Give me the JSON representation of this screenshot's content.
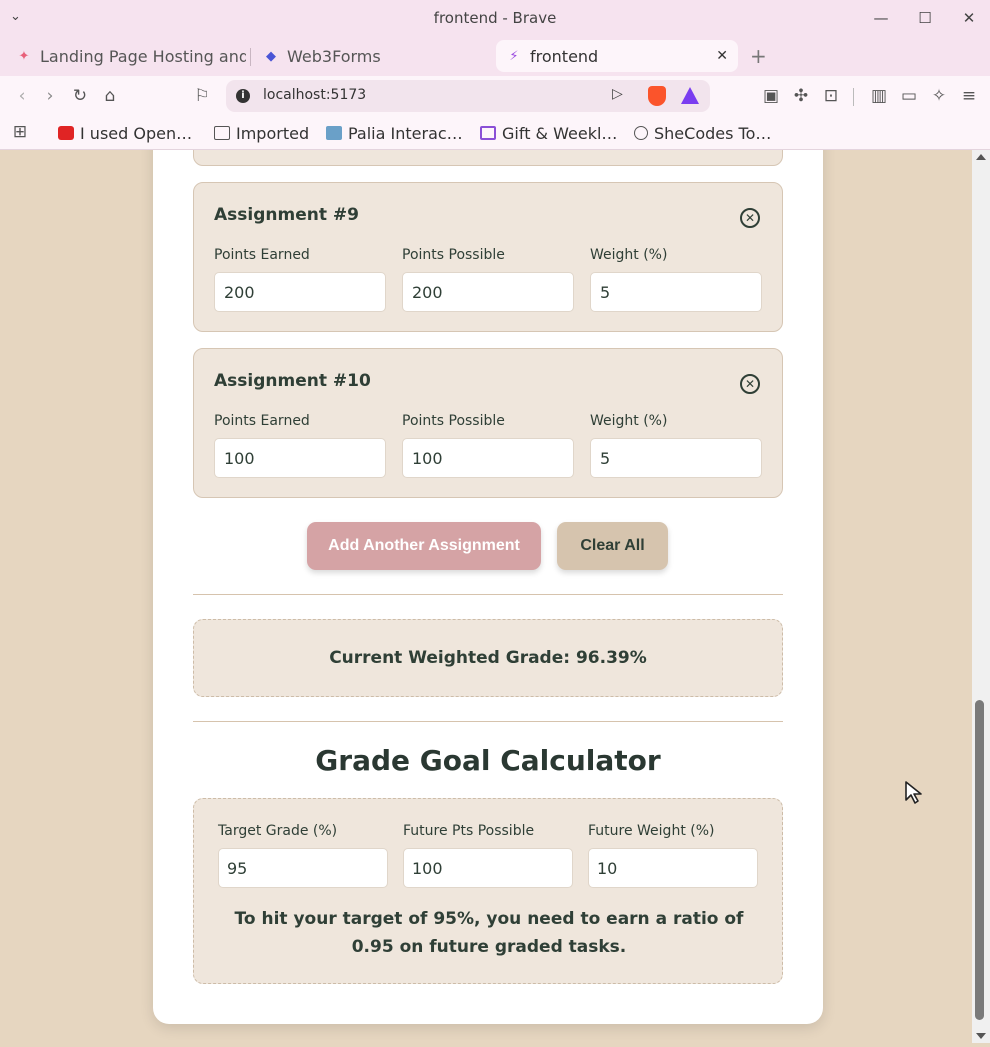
{
  "window": {
    "title": "frontend - Brave"
  },
  "tabs": [
    {
      "label": "Landing Page Hosting and"
    },
    {
      "label": "Web3Forms"
    },
    {
      "label": "frontend"
    }
  ],
  "address": {
    "url": "localhost:5173"
  },
  "bookmarks": [
    {
      "label": "I used Open…"
    },
    {
      "label": "Imported"
    },
    {
      "label": "Palia Interac…"
    },
    {
      "label": "Gift & Weekl…"
    },
    {
      "label": "SheCodes To…"
    }
  ],
  "labels": {
    "points_earned": "Points Earned",
    "points_possible": "Points Possible",
    "weight": "Weight (%)"
  },
  "assignments": [
    {
      "title": "Assignment #9",
      "earned": "200",
      "possible": "200",
      "weight": "5"
    },
    {
      "title": "Assignment #10",
      "earned": "100",
      "possible": "100",
      "weight": "5"
    }
  ],
  "actions": {
    "add_label": "Add Another Assignment",
    "clear_label": "Clear All"
  },
  "result": {
    "current_grade_text": "Current Weighted Grade: 96.39%"
  },
  "goal": {
    "title": "Grade Goal Calculator",
    "target_label": "Target Grade (%)",
    "target_value": "95",
    "future_pts_label": "Future Pts Possible",
    "future_pts_value": "100",
    "future_weight_label": "Future Weight (%)",
    "future_weight_value": "10",
    "message": "To hit your target of 95%, you need to earn a ratio of 0.95 on future graded tasks."
  },
  "colors": {
    "page_bg": "#e6d6c0",
    "card_bg": "#efe6dc",
    "add_button": "#d5a3a5",
    "clear_button": "#d6c4ae",
    "text": "#2f3f36"
  }
}
